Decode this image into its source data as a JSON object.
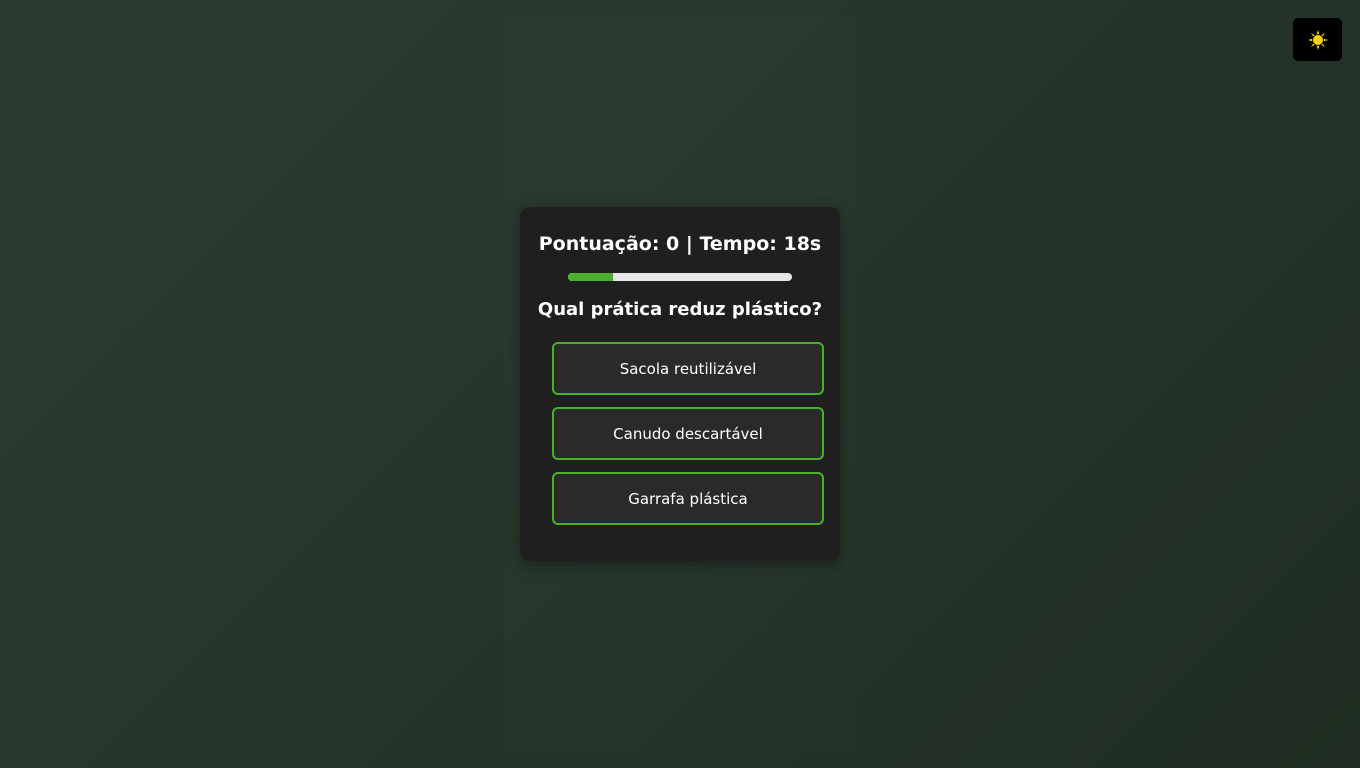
{
  "theme_toggle": {
    "icon": "sun-icon",
    "icon_color": "#ffd400"
  },
  "quiz": {
    "score_label": "Pontuação:",
    "score_value": "0",
    "separator": "|",
    "time_label": "Tempo:",
    "time_value": "18s",
    "timer_progress_percent": 20,
    "question": "Qual prática reduz plástico?",
    "answers": [
      "Sacola reutilizável",
      "Canudo descartável",
      "Garrafa plástica"
    ]
  },
  "colors": {
    "accent": "#4caf2a",
    "card_background": "#1f1f1f",
    "button_background": "#2a2a2a",
    "text": "#ffffff"
  }
}
